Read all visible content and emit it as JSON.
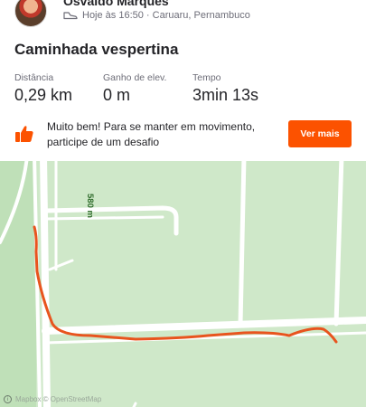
{
  "athlete": {
    "name": "Osvaldo Marques",
    "meta": "Hoje às 16:50 · Caruaru, Pernambuco"
  },
  "activity": {
    "title": "Caminhada vespertina",
    "stats": [
      {
        "label": "Distância",
        "value": "0,29 km"
      },
      {
        "label": "Ganho de elev.",
        "value": "0 m"
      },
      {
        "label": "Tempo",
        "value": "3min 13s"
      }
    ]
  },
  "promo": {
    "text": "Muito bem! Para se manter em movimento, participe de um desafio",
    "button_label": "Ver mais"
  },
  "map": {
    "elevation_label": "580 m",
    "attribution": "Mapbox © OpenStreetMap",
    "route_color": "#e8541e",
    "land_color": "#cfe8c9",
    "road_color": "#ffffff"
  },
  "colors": {
    "accent": "#fc5200"
  },
  "icons": {
    "activity_type": "shoe-icon",
    "promo": "thumbs-up-icon",
    "info": "info-icon"
  }
}
